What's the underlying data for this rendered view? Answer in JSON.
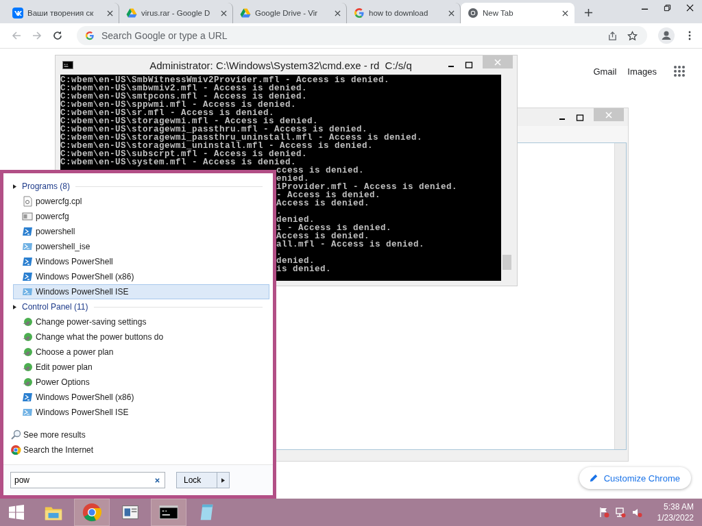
{
  "browser": {
    "tabs": [
      {
        "title": "Ваши творения ск",
        "kind": "vk",
        "selected": false
      },
      {
        "title": "virus.rar - Google D",
        "kind": "drive",
        "selected": false
      },
      {
        "title": "Google Drive - Vir",
        "kind": "drive",
        "selected": false
      },
      {
        "title": "how to download",
        "kind": "google",
        "selected": false
      },
      {
        "title": "New Tab",
        "kind": "chrome",
        "selected": true
      }
    ],
    "omnibox": {
      "placeholder": "Search Google or type a URL"
    }
  },
  "page": {
    "links": [
      "Gmail",
      "Images"
    ],
    "customize_button": "Customize Chrome"
  },
  "cmd_window": {
    "title": "Administrator: C:\\Windows\\System32\\cmd.exe - rd  C:/s/q",
    "lines": [
      {
        "text": "C:wbem\\en-US\\SmbWitnessWmiv2Provider.mfl - Access is denied.",
        "kind": "full"
      },
      {
        "text": "C:wbem\\en-US\\smbwmiv2.mfl - Access is denied.",
        "kind": "full"
      },
      {
        "text": "C:wbem\\en-US\\smtpcons.mfl - Access is denied.",
        "kind": "full"
      },
      {
        "text": "C:wbem\\en-US\\sppwmi.mfl - Access is denied.",
        "kind": "full"
      },
      {
        "text": "C:wbem\\en-US\\sr.mfl - Access is denied.",
        "kind": "full"
      },
      {
        "text": "C:wbem\\en-US\\storagewmi.mfl - Access is denied.",
        "kind": "full"
      },
      {
        "text": "C:wbem\\en-US\\storagewmi_passthru.mfl - Access is denied.",
        "kind": "full"
      },
      {
        "text": "C:wbem\\en-US\\storagewmi_passthru_uninstall.mfl - Access is denied.",
        "kind": "full"
      },
      {
        "text": "C:wbem\\en-US\\storagewmi_uninstall.mfl - Access is denied.",
        "kind": "full"
      },
      {
        "text": "C:wbem\\en-US\\subscrpt.mfl - Access is denied.",
        "kind": "full"
      },
      {
        "text": "C:wbem\\en-US\\system.mfl - Access is denied.",
        "kind": "full"
      },
      {
        "text": "ccess is denied.",
        "kind": "partial"
      },
      {
        "text": "enied.",
        "kind": "partial"
      },
      {
        "text": "iProvider.mfl - Access is denied.",
        "kind": "partial"
      },
      {
        "text": "- Access is denied.",
        "kind": "partial"
      },
      {
        "text": "Access is denied.",
        "kind": "partial"
      },
      {
        "text": ".",
        "kind": "partial"
      },
      {
        "text": "denied.",
        "kind": "partial"
      },
      {
        "text": "i - Access is denied.",
        "kind": "partial"
      },
      {
        "text": "Access is denied.",
        "kind": "partial"
      },
      {
        "text": "all.mfl - Access is denied.",
        "kind": "partial"
      },
      {
        "text": ".",
        "kind": "partial"
      },
      {
        "text": "denied.",
        "kind": "partial"
      },
      {
        "text": "is denied.",
        "kind": "partial"
      }
    ]
  },
  "start_menu": {
    "groups": [
      {
        "label": "Programs (8)",
        "items": [
          {
            "label": "powercfg.cpl",
            "kind": "cpl",
            "selected": false
          },
          {
            "label": "powercfg",
            "kind": "exe",
            "selected": false
          },
          {
            "label": "powershell",
            "kind": "ps",
            "selected": false
          },
          {
            "label": "powershell_ise",
            "kind": "ise",
            "selected": false
          },
          {
            "label": "Windows PowerShell",
            "kind": "ps",
            "selected": false
          },
          {
            "label": "Windows PowerShell (x86)",
            "kind": "ps",
            "selected": false
          },
          {
            "label": "Windows PowerShell ISE",
            "kind": "ise",
            "selected": true
          }
        ]
      },
      {
        "label": "Control Panel (11)",
        "items": [
          {
            "label": "Change power-saving settings",
            "kind": "power",
            "selected": false
          },
          {
            "label": "Change what the power buttons do",
            "kind": "power",
            "selected": false
          },
          {
            "label": "Choose a power plan",
            "kind": "power",
            "selected": false
          },
          {
            "label": "Edit power plan",
            "kind": "power",
            "selected": false
          },
          {
            "label": "Power Options",
            "kind": "power",
            "selected": false
          },
          {
            "label": "Windows PowerShell (x86)",
            "kind": "ps",
            "selected": false
          },
          {
            "label": "Windows PowerShell ISE",
            "kind": "ise",
            "selected": false
          }
        ]
      }
    ],
    "footer_links": [
      {
        "label": "See more results",
        "kind": "search"
      },
      {
        "label": "Search the Internet",
        "kind": "chrome"
      }
    ],
    "search": {
      "value": "pow"
    },
    "lock_button": "Lock"
  },
  "taskbar": {
    "apps": [
      {
        "kind": "explorer",
        "active": false
      },
      {
        "kind": "chrome",
        "active": true
      },
      {
        "kind": "window",
        "active": false
      },
      {
        "kind": "cmd",
        "active": true
      },
      {
        "kind": "notepad",
        "active": false
      }
    ],
    "clock": {
      "time": "5:38 AM",
      "date": "1/23/2022"
    }
  }
}
